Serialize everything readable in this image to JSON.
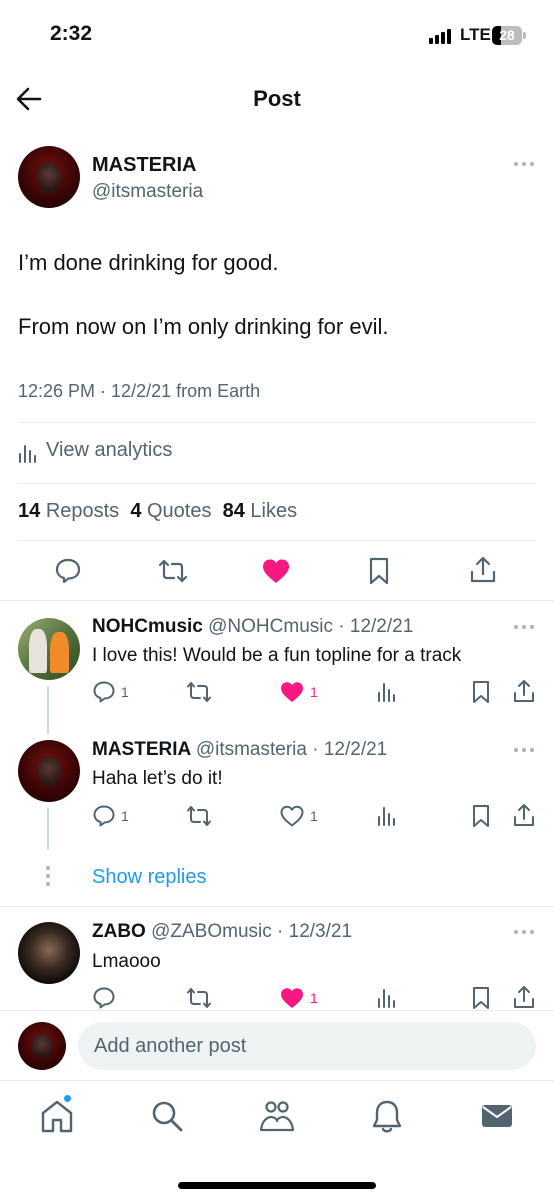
{
  "status_bar": {
    "time": "2:32",
    "network": "LTE",
    "battery": "28"
  },
  "header": {
    "title": "Post"
  },
  "post": {
    "name": "MASTERIA",
    "handle": "@itsmasteria",
    "line1": "I’m done drinking for good.",
    "line2": "From now on I’m only drinking for evil.",
    "meta": "12:26 PM · 12/2/21 from Earth",
    "analytics_label": "View analytics",
    "reposts_count": "14",
    "reposts_label": "Reposts",
    "quotes_count": "4",
    "quotes_label": "Quotes",
    "likes_count": "84",
    "likes_label": "Likes",
    "liked": true
  },
  "replies": [
    {
      "name": "NOHCmusic",
      "meta": "@NOHCmusic · 12/2/21",
      "text": "I love this!  Would be a fun topline for a track",
      "reply_count": "1",
      "like_count": "1",
      "liked": true
    },
    {
      "name": "MASTERIA",
      "meta": "@itsmasteria · 12/2/21",
      "text": "Haha let’s do it!",
      "reply_count": "1",
      "like_count": "1",
      "liked": false
    },
    {
      "name": "ZABO",
      "meta": "@ZABOmusic · 12/3/21",
      "text": "Lmaooo",
      "reply_count": "",
      "like_count": "1",
      "liked": true
    }
  ],
  "show_replies_label": "Show replies",
  "compose": {
    "placeholder": "Add another post"
  },
  "tabbar": [
    "home-icon",
    "search-icon",
    "communities-icon",
    "notifications-icon",
    "messages-icon"
  ],
  "colors": {
    "like": "#f91880",
    "link": "#1d9bf0",
    "secondary_text": "#536471"
  }
}
